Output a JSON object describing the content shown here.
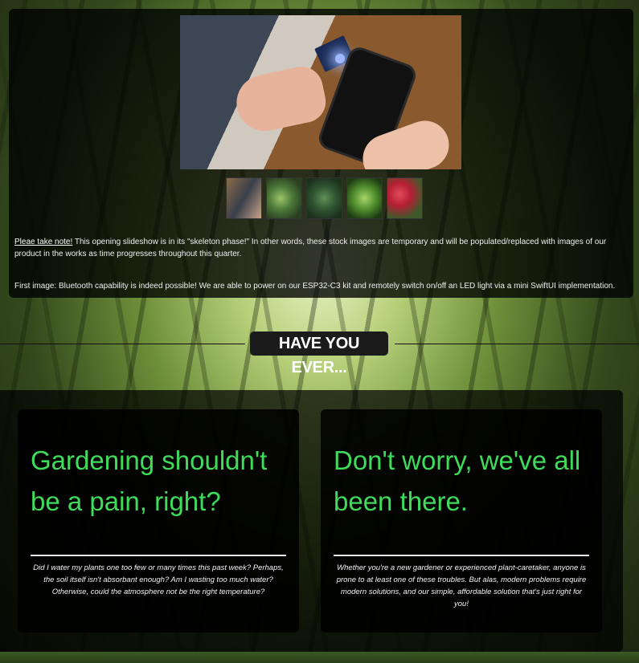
{
  "slideshow": {
    "thumbnails": [
      "thumbnail-bluetooth",
      "thumbnail-succulent",
      "thumbnail-leaves",
      "thumbnail-fern",
      "thumbnail-roses"
    ],
    "note_link": "Pleae take note!",
    "note_text": " This opening slideshow is in its \"skeleton phase!\" In other words, these stock images are temporary and will be populated/replaced with images of our product in the works as time progresses throughout this quarter.",
    "first_image_text": "First image: Bluetooth capability is indeed possible! We are able to power on our ESP32-C3 kit and remotely switch on/off an LED light via a mini SwiftUI implementation."
  },
  "section": {
    "heading": "HAVE YOU EVER..."
  },
  "cards": [
    {
      "title": "Gardening shouldn't be a pain, right?",
      "body": "Did I water my plants one too few or many times this past week? Perhaps, the soil itself isn't absorbant enough? Am I wasting too much water? Otherwise, could the atmosphere not be the right temperature?"
    },
    {
      "title": "Don't worry, we've all been there.",
      "body": "Whether you're a new gardener or experienced plant-caretaker, anyone is prone to at least one of these troubles. But alas, modern problems require modern solutions, and our simple, affordable solution that's just right for you!"
    }
  ],
  "colors": {
    "accent_green": "#3fdc5c",
    "panel_dark": "#000000"
  }
}
